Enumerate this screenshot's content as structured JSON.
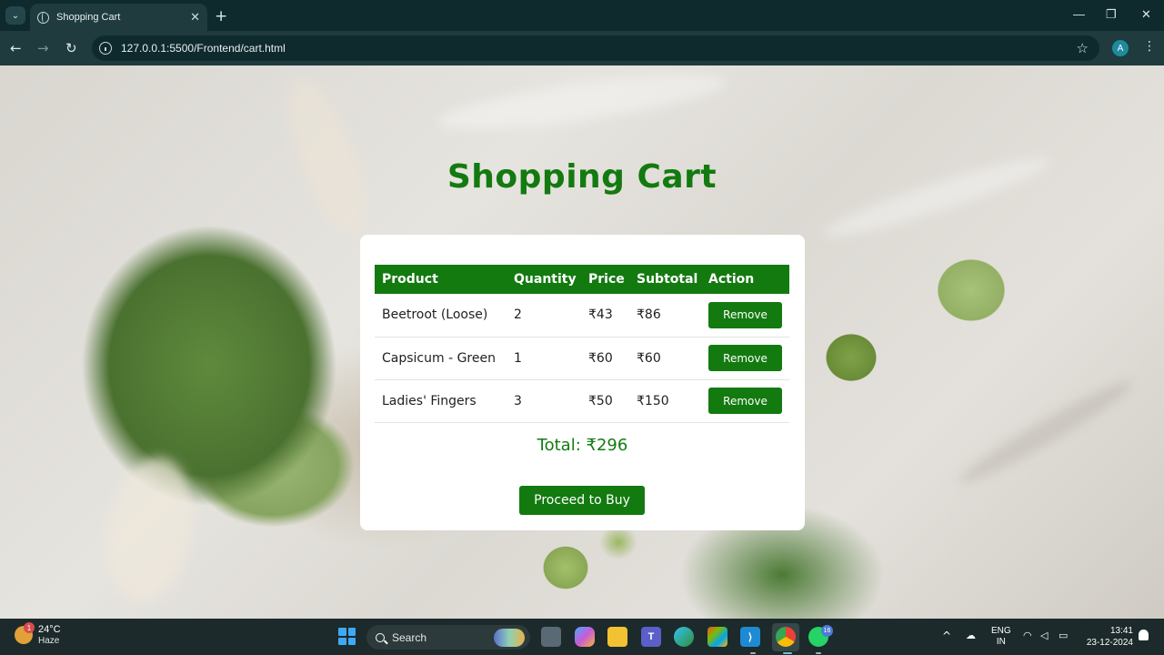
{
  "browser": {
    "tab_title": "Shopping Cart",
    "tab_close": "✕",
    "new_tab": "+",
    "url": "127.0.0.1:5500/Frontend/cart.html",
    "profile_initial": "A",
    "window_controls": {
      "minimize": "—",
      "maximize": "❐",
      "close": "✕"
    }
  },
  "page": {
    "title": "Shopping Cart",
    "table": {
      "headers": [
        "Product",
        "Quantity",
        "Price",
        "Subtotal",
        "Action"
      ],
      "rows": [
        {
          "product": "Beetroot (Loose)",
          "quantity": "2",
          "price": "₹43",
          "subtotal": "₹86",
          "action": "Remove"
        },
        {
          "product": "Capsicum - Green",
          "quantity": "1",
          "price": "₹60",
          "subtotal": "₹60",
          "action": "Remove"
        },
        {
          "product": "Ladies' Fingers",
          "quantity": "3",
          "price": "₹50",
          "subtotal": "₹150",
          "action": "Remove"
        }
      ]
    },
    "total": "Total: ₹296",
    "proceed_label": "Proceed to Buy"
  },
  "taskbar": {
    "weather": {
      "temp": "24°C",
      "condition": "Haze",
      "badge": "1"
    },
    "search_placeholder": "Search",
    "whatsapp_badge": "16",
    "chrome_badge": "A",
    "language": {
      "line1": "ENG",
      "line2": "IN"
    },
    "clock": {
      "time": "13:41",
      "date": "23-12-2024"
    }
  },
  "colors": {
    "accent": "#137a10",
    "chrome_bg": "#0e2a2c",
    "taskbar_bg": "#1c2a2b"
  },
  "icons": {
    "taskbar": [
      "windows-start-icon",
      "task-view-icon",
      "copilot-icon",
      "file-explorer-icon",
      "teams-icon",
      "edge-icon",
      "store-icon",
      "vscode-icon",
      "chrome-icon",
      "whatsapp-icon"
    ]
  }
}
